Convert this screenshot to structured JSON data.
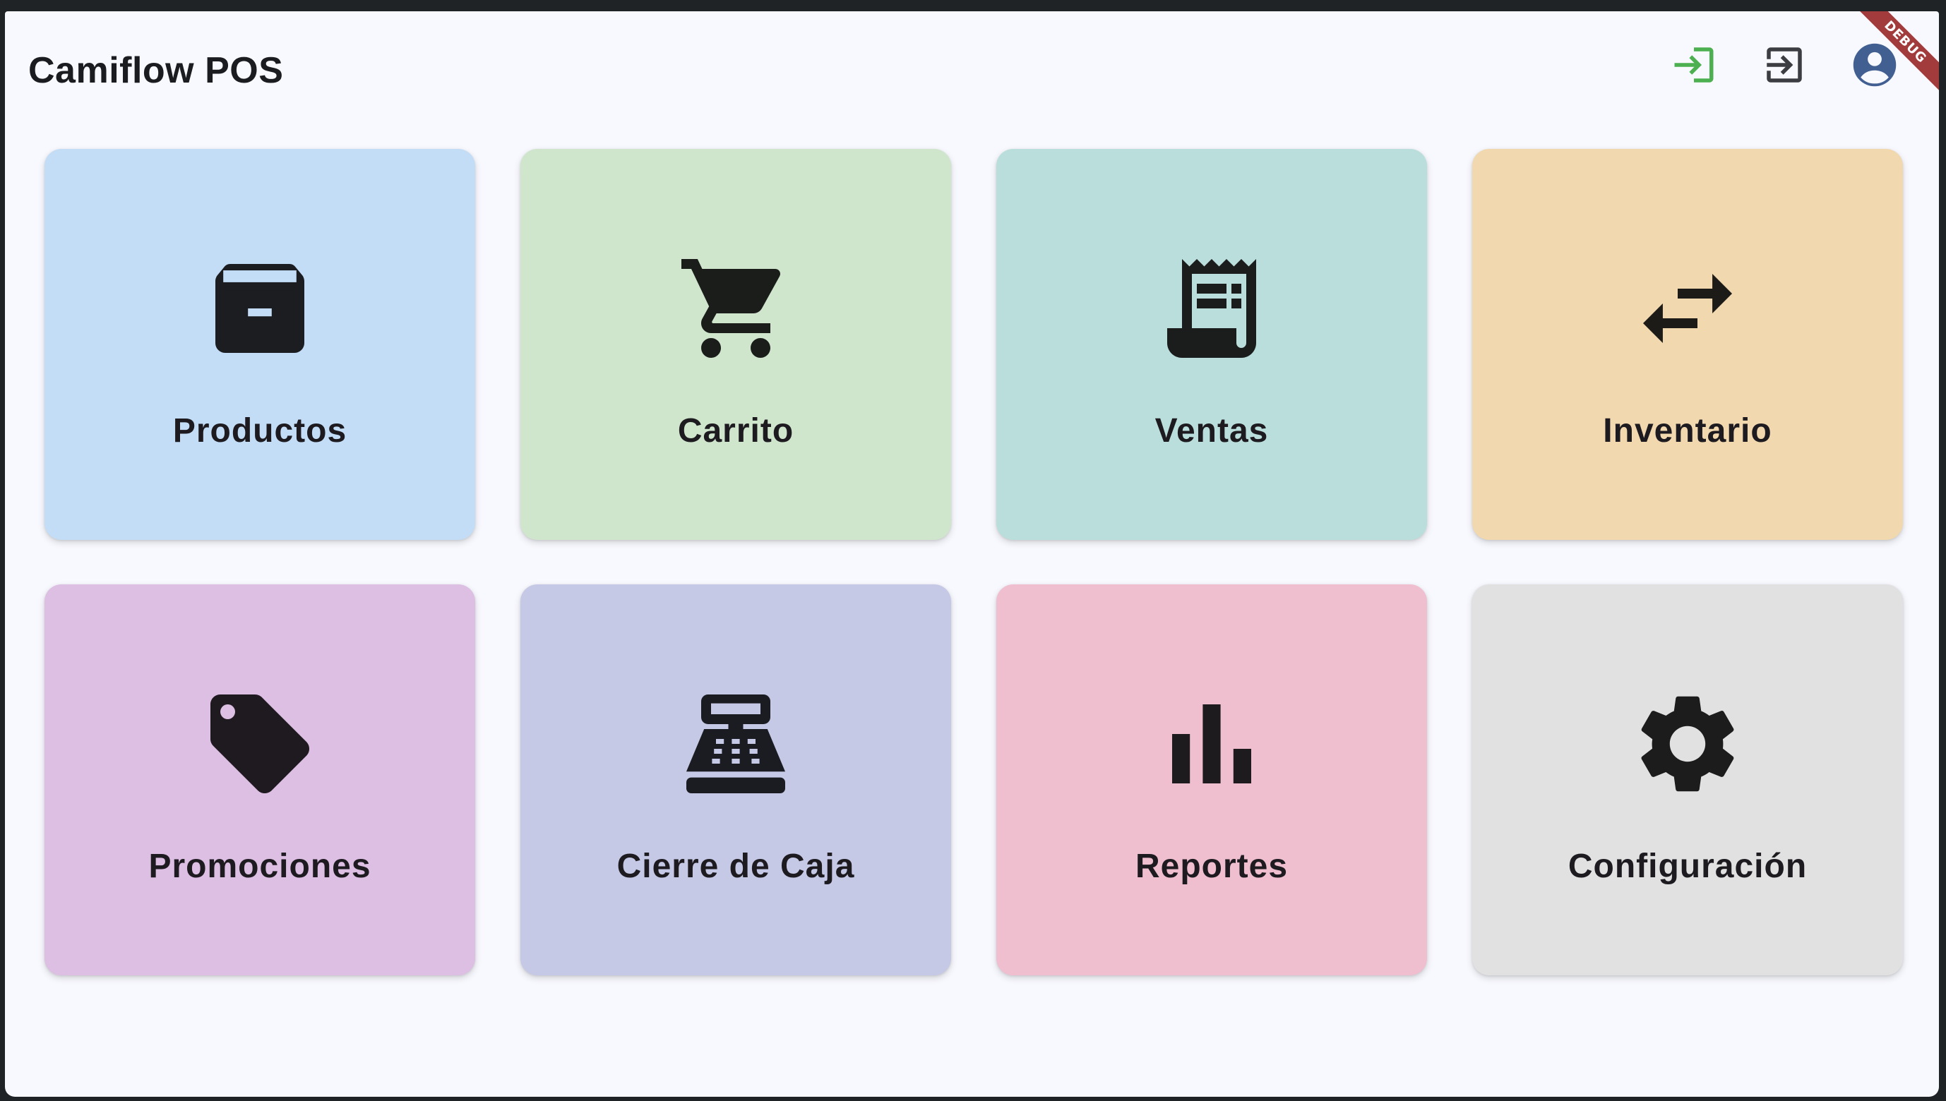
{
  "app": {
    "title": "Camiflow POS",
    "debug_banner": "DEBUG"
  },
  "toolbar": {
    "buttons": [
      {
        "name": "login-button",
        "icon": "login-icon",
        "color": "#4caf50"
      },
      {
        "name": "logout-button",
        "icon": "logout-icon",
        "color": "#3c3d42"
      },
      {
        "name": "profile-button",
        "icon": "account-circle-icon",
        "color": "#415f91"
      }
    ]
  },
  "tiles": [
    {
      "label": "Productos",
      "icon": "archive-box-icon",
      "color": "#c3ddf7"
    },
    {
      "label": "Carrito",
      "icon": "shopping-cart-icon",
      "color": "#cfe5cc"
    },
    {
      "label": "Ventas",
      "icon": "receipt-icon",
      "color": "#badedc"
    },
    {
      "label": "Inventario",
      "icon": "swap-arrows-icon",
      "color": "#f2d8ae"
    },
    {
      "label": "Promociones",
      "icon": "tag-icon",
      "color": "#ddbfe3"
    },
    {
      "label": "Cierre de Caja",
      "icon": "cash-register-icon",
      "color": "#c5c9e6"
    },
    {
      "label": "Reportes",
      "icon": "bar-chart-icon",
      "color": "#f0bfcf"
    },
    {
      "label": "Configuración",
      "icon": "gear-icon",
      "color": "#e1e1e1"
    }
  ]
}
